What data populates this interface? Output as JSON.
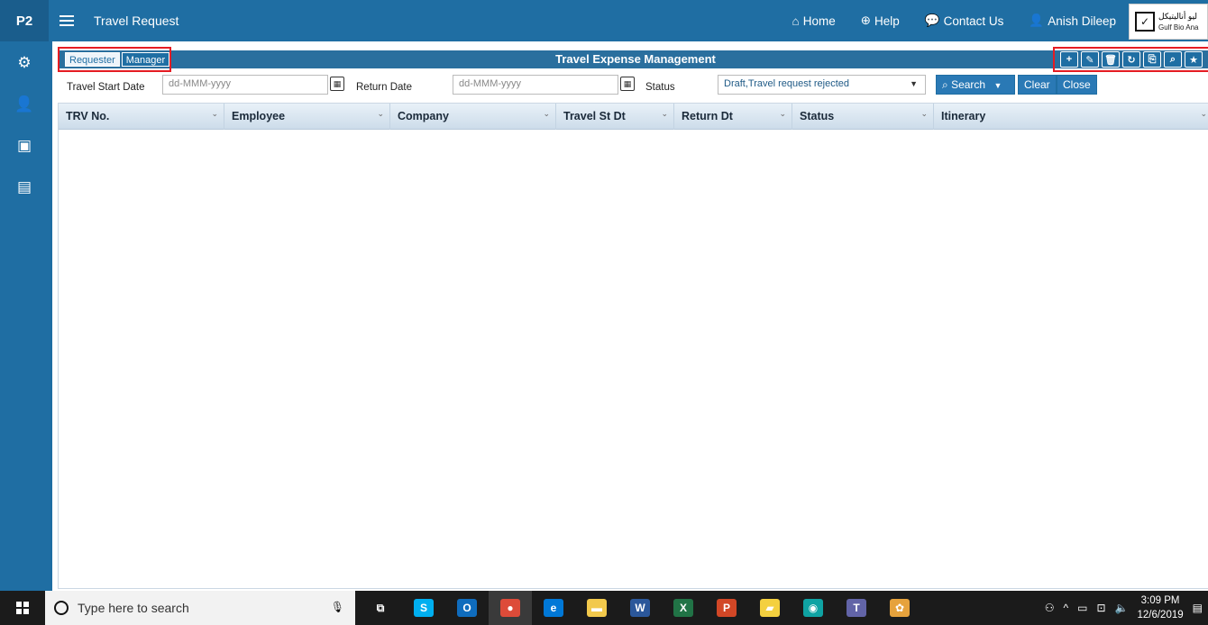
{
  "topbar": {
    "brand": "P2",
    "app_title": "Travel Request",
    "nav": [
      {
        "label": "Home",
        "icon": "home-icon"
      },
      {
        "label": "Help",
        "icon": "help-icon"
      },
      {
        "label": "Contact Us",
        "icon": "chat-icon"
      },
      {
        "label": "Anish Dileep",
        "icon": "user-icon"
      }
    ],
    "logo": {
      "line1": "ليو أناليتيكل",
      "line2": "Gulf Bio Ana"
    }
  },
  "sidebar": {
    "items": [
      {
        "icon": "gear-icon"
      },
      {
        "icon": "user-icon"
      },
      {
        "icon": "money-icon"
      },
      {
        "icon": "contact-card-icon"
      }
    ]
  },
  "panel": {
    "title": "Travel Expense Management",
    "toggle": {
      "requester": "Requester",
      "manager": "Manager"
    },
    "tools": [
      {
        "icon": "add-icon",
        "glyph": "+"
      },
      {
        "icon": "edit-icon",
        "glyph": "✎"
      },
      {
        "icon": "delete-icon",
        "glyph": "🗑"
      },
      {
        "icon": "refresh-icon",
        "glyph": "↻"
      },
      {
        "icon": "export-icon",
        "glyph": "⎘"
      },
      {
        "icon": "search-icon",
        "glyph": "⌕"
      },
      {
        "icon": "star-icon",
        "glyph": "★"
      }
    ]
  },
  "filters": {
    "travel_start_label": "Travel Start Date",
    "travel_start_placeholder": "dd-MMM-yyyy",
    "return_label": "Return Date",
    "return_placeholder": "dd-MMM-yyyy",
    "status_label": "Status",
    "status_value": "Draft,Travel request rejected",
    "search_label": "Search",
    "clear_label": "Clear",
    "close_label": "Close"
  },
  "grid": {
    "columns": [
      "TRV No.",
      "Employee",
      "Company",
      "Travel St Dt",
      "Return Dt",
      "Status",
      "Itinerary"
    ],
    "rows": []
  },
  "taskbar": {
    "search_placeholder": "Type here to search",
    "apps": [
      {
        "icon": "task-view-icon",
        "glyph": "⧉",
        "color": "#1b1b1b"
      },
      {
        "icon": "skype-icon",
        "glyph": "S",
        "color": "#00aff0"
      },
      {
        "icon": "outlook-icon",
        "glyph": "O",
        "color": "#0f6cbd"
      },
      {
        "icon": "chrome-icon",
        "glyph": "●",
        "color": "#dd4b39"
      },
      {
        "icon": "edge-icon",
        "glyph": "e",
        "color": "#0078d7"
      },
      {
        "icon": "file-explorer-icon",
        "glyph": "▬",
        "color": "#f2c94c"
      },
      {
        "icon": "word-icon",
        "glyph": "W",
        "color": "#2b579a"
      },
      {
        "icon": "excel-icon",
        "glyph": "X",
        "color": "#217346"
      },
      {
        "icon": "powerpoint-icon",
        "glyph": "P",
        "color": "#d24726"
      },
      {
        "icon": "sticky-notes-icon",
        "glyph": "▰",
        "color": "#f4d03f"
      },
      {
        "icon": "teams-meeting-icon",
        "glyph": "◉",
        "color": "#0fa3a3"
      },
      {
        "icon": "teams-icon",
        "glyph": "T",
        "color": "#6264a7"
      },
      {
        "icon": "paint-icon",
        "glyph": "✿",
        "color": "#e6a23c"
      }
    ],
    "time": "3:09 PM",
    "date": "12/6/2019"
  }
}
